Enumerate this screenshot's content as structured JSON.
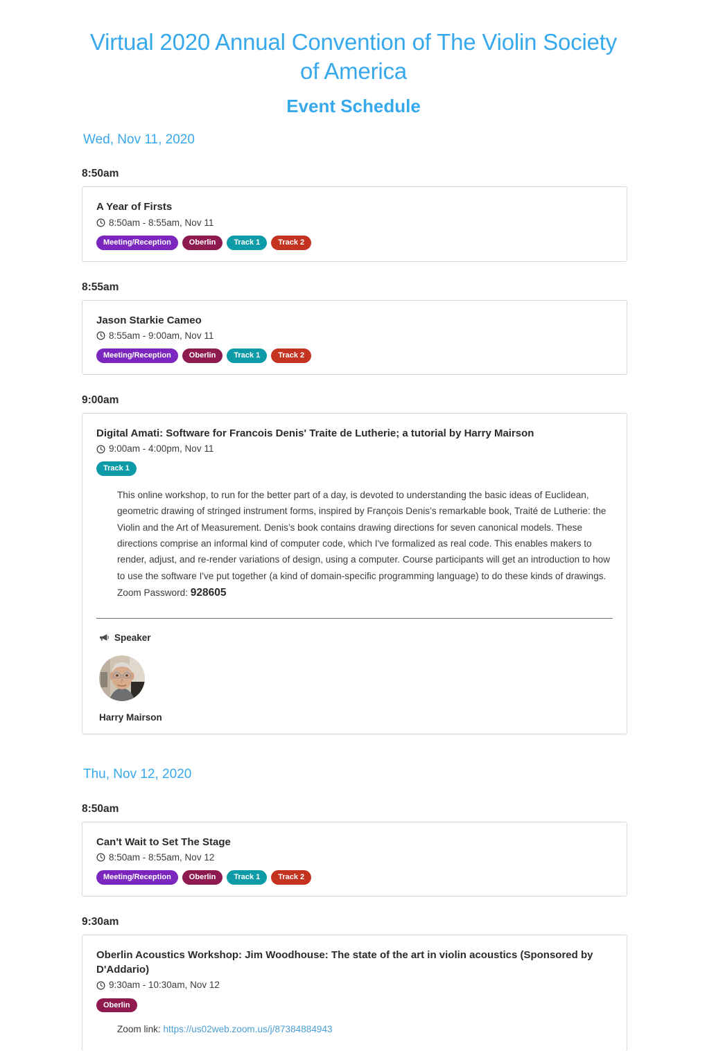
{
  "header": {
    "title": "Virtual 2020 Annual Convention of The Violin Society of America",
    "subtitle": "Event Schedule",
    "title_color": "#36a8ec"
  },
  "badge_colors": {
    "Meeting/Reception": "#7b26bf",
    "Oberlin": "#8e1a50",
    "Track 1": "#0d9ba8",
    "Track 2": "#c3331f"
  },
  "icons": {
    "clock": "clock-icon",
    "megaphone": "megaphone-icon"
  },
  "days": [
    {
      "label": "Wed, Nov 11, 2020",
      "slots": [
        {
          "time": "8:50am",
          "event": {
            "title": "A Year of Firsts",
            "time_range": "8:50am - 8:55am, Nov 11",
            "badges": [
              "Meeting/Reception",
              "Oberlin",
              "Track 1",
              "Track 2"
            ]
          }
        },
        {
          "time": "8:55am",
          "event": {
            "title": "Jason Starkie Cameo",
            "time_range": "8:55am - 9:00am, Nov 11",
            "badges": [
              "Meeting/Reception",
              "Oberlin",
              "Track 1",
              "Track 2"
            ]
          }
        },
        {
          "time": "9:00am",
          "event": {
            "title": "Digital Amati: Software for Francois Denis' Traite de Lutherie; a tutorial by Harry Mairson",
            "time_range": "9:00am - 4:00pm, Nov 11",
            "badges": [
              "Track 1"
            ],
            "description": "This online workshop, to run for the better part of a day, is devoted to understanding the basic ideas of Euclidean, geometric drawing of stringed instrument forms, inspired by François Denis’s remarkable book, Traité de Lutherie: the Violin and the Art of Measurement. Denis’s book contains drawing directions for seven canonical models.  These directions comprise an informal kind of computer code, which I've formalized as real code.  This enables makers to render, adjust, and re-render variations of design, using a computer.  Course participants will get an introduction to how to use the software I've put together (a kind of domain-specific programming language) to do these kinds of drawings. Zoom Password: ",
            "password": "928605",
            "speaker_heading": "Speaker",
            "speaker_name": "Harry Mairson"
          }
        }
      ]
    },
    {
      "label": "Thu, Nov 12, 2020",
      "slots": [
        {
          "time": "8:50am",
          "event": {
            "title": "Can't Wait to Set The Stage",
            "time_range": "8:50am - 8:55am, Nov 12",
            "badges": [
              "Meeting/Reception",
              "Oberlin",
              "Track 1",
              "Track 2"
            ]
          }
        },
        {
          "time": "9:30am",
          "event": {
            "title": "Oberlin Acoustics Workshop: Jim Woodhouse: The state of the art in violin acoustics (Sponsored by D'Addario)",
            "time_range": "9:30am - 10:30am, Nov 12",
            "badges": [
              "Oberlin"
            ],
            "zoom_label": "Zoom link: ",
            "zoom_url": "https://us02web.zoom.us/j/87384884943"
          }
        }
      ]
    }
  ]
}
